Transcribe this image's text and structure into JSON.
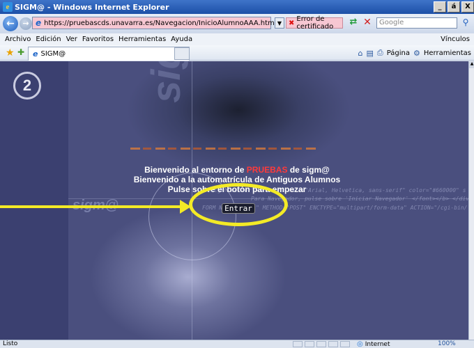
{
  "window": {
    "title": "SIGM@ - Windows Internet Explorer",
    "controls": [
      "_",
      "á",
      "X"
    ]
  },
  "address": {
    "url": "https://pruebascds.unavarra.es/Navegacion/InicioAlumnoAAA.html",
    "cert_error": "Error de certificado",
    "search_placeholder": "Google"
  },
  "menu": {
    "items": [
      "Archivo",
      "Edición",
      "Ver",
      "Favoritos",
      "Herramientas",
      "Ayuda"
    ],
    "links": "Vínculos"
  },
  "tab": {
    "title": "SIGM@"
  },
  "commandbar": {
    "page": "Página",
    "tools": "Herramientas"
  },
  "page": {
    "step_number": "2",
    "watermark": "sigm@",
    "welcome_line1_prefix": "Bienvenido al entorno de ",
    "welcome_line1_highlight": "PRUEBAS",
    "welcome_line1_suffix": " de sigm@",
    "welcome_line2": "Bienvenido a la automatrícula de Antiguos Alumnos",
    "welcome_line3": "Pulse sobre el botón para empezar",
    "enter_button": "Entrar",
    "code_ghost": [
      "p align=\"center\"><b><font face=\"Arial, Helvetica, sans-serif\" color=\"#660000\" s",
      "Para Navegador, pulse sobre 'Iniciar Navegador' </font></b> </div",
      "FORM NAME=\"form1\" METHOD=\"POST\" ENCTYPE=\"multipart/form-data\" ACTION=\"/cgi-bin/"
    ]
  },
  "status": {
    "text": "Listo",
    "zone": "Internet",
    "zoom": "100%"
  },
  "colors": {
    "highlight": "#f3ea26",
    "pruebas": "#ff3a3a"
  }
}
